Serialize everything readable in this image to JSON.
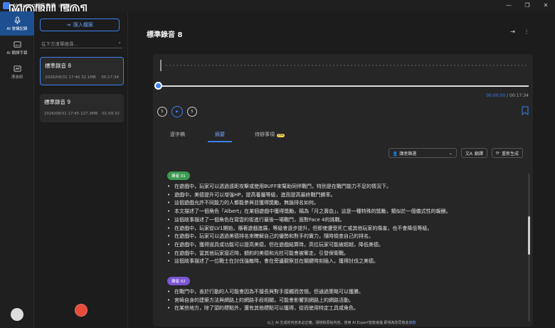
{
  "titlebar": {
    "app_title": "AI Expert智能會議",
    "beta": "BETA",
    "controls": [
      "—",
      "❐",
      "✕"
    ]
  },
  "watermark": "MOBILE01",
  "rail": {
    "items": [
      {
        "label": "AI 會議記錄",
        "icon": "mic-icon",
        "active": true
      },
      {
        "label": "AI 翻譯字幕",
        "icon": "subtitle-icon",
        "active": false
      },
      {
        "label": "浮水印",
        "icon": "watermark-icon",
        "active": false
      }
    ]
  },
  "list": {
    "import_label": "匯入檔案",
    "search_placeholder": "在下方清單搜尋...",
    "recordings": [
      {
        "title": "標準錄音 8",
        "date": "2026/08/31 17:46",
        "size": "32.1MB",
        "duration": "00:17:34",
        "selected": true
      },
      {
        "title": "標準錄音 9",
        "date": "2026/08/31 17:45",
        "size": "127.3MB",
        "duration": "01:09:32",
        "selected": false
      }
    ]
  },
  "main": {
    "title": "標準錄音 8",
    "player": {
      "current": "00:00:00",
      "total": "/ 00:17:34",
      "progress": 0.0,
      "rew_label": "5",
      "fwd_label": "5"
    },
    "tabs": [
      {
        "label": "逐字稿",
        "active": false
      },
      {
        "label": "摘要",
        "active": true
      },
      {
        "label": "待辦事項",
        "active": false,
        "badge": "Pro"
      }
    ],
    "tools": {
      "speaker_select": "講者篩選",
      "translate": "翻譯",
      "regenerate": "重新生成"
    },
    "summary": [
      {
        "speaker": "講者 01",
        "color": "#3c9a50",
        "bullets": [
          "在遊戲中，玩家可以透過遠距攻擊或使用BUFF來幫助同伴戰鬥，特別是在戰鬥能力不足的情況下。",
          "遊戲中，美德提升可以增強HP，提高養屬等級，進而提高最終戰鬥勝率。",
          "這個遊戲允許不同能力的人都能參與並獲得獎勵，無論排名如何。",
          "本文描述了一個角色「Albert」在某個遊戲中獲得獎勵，稱為「月之壽血」，這是一種特殊的獎勵，類似於一個儀式性的報酬。",
          "這個故事描述了一個角色在寫雲的街進行最後一場戰鬥，面對Face 4的挑戰。",
          "在遊戲中，玩家從LV1開始，隨著遊戲進展，等級會逐步提升，但即使遭受死亡或其他玩家的傷害，也不會降低等級。",
          "在遊戲中，玩家可以透過美德排名來瞭解自己的優勢和對手的實力，隨時檢查自己的排名。",
          "在遊戲中，獲得道具或功能可以提高美德，但在遊戲結算時，高位玩家可能被超越，降低美德。",
          "在遊戲中，當其他玩家接近時，額約的美德和光柱可能會被奪走，引發保衛戰。",
          "這個故事描述了一位戰士在討伐強敵時，會在旁邊觀察並在關鍵時刻插入，獲得討伐之美德。"
        ]
      },
      {
        "speaker": "講者 02",
        "color": "#7b55d4",
        "bullets": [
          "在戰鬥中，善於行動的人可能會因為不擅長與對手接觸而苦惱，但通過策略可以獲勝。",
          "宮崎自身的建築方法與網路上的網路手段相關，可能會影響到網路上的網路活動。",
          "在某些地方，除了頭的標點外，還有其他標點可以獲得，從而使用特定工具或角色。"
        ]
      }
    ],
    "footer": "以上 AI 生成的內容未必正確，請核對原始內容。使用 AI Expert智能會議 即視為您同意此",
    "footer_link": "條款"
  }
}
